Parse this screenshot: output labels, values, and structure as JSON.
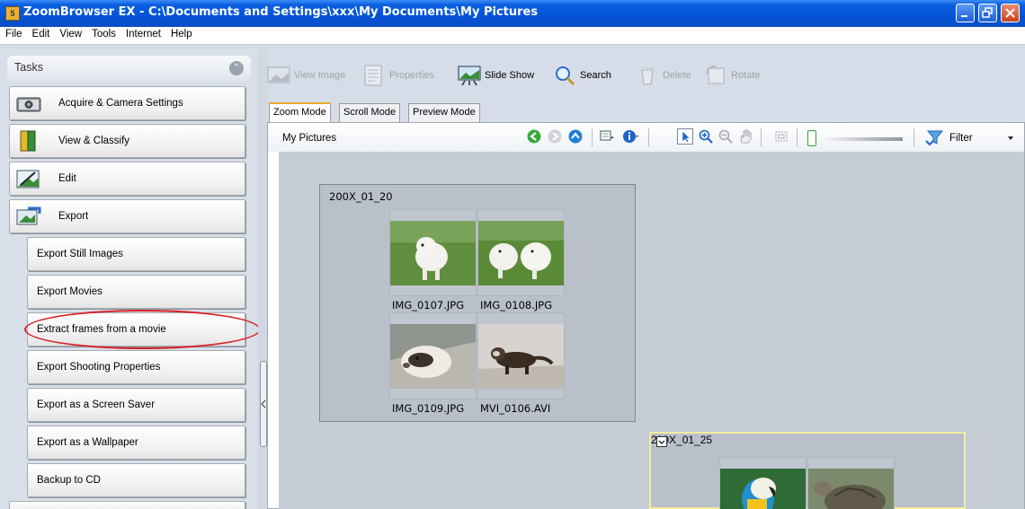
{
  "window": {
    "title": "ZoomBrowser EX  -  C:\\Documents and Settings\\xxx\\My Documents\\My Pictures"
  },
  "menubar": [
    "File",
    "Edit",
    "View",
    "Tools",
    "Internet",
    "Help"
  ],
  "tasks": {
    "header": "Tasks",
    "buttons": [
      {
        "label": "Acquire & Camera Settings",
        "icon": "camera-icon"
      },
      {
        "label": "View & Classify",
        "icon": "book-icon"
      },
      {
        "label": "Edit",
        "icon": "edit-icon"
      },
      {
        "label": "Export",
        "icon": "export-icon"
      }
    ],
    "export_items": [
      "Export Still Images",
      "Export Movies",
      "Extract frames from a movie",
      "Export Shooting Properties",
      "Export as a Screen Saver",
      "Export as a Wallpaper",
      "Backup to CD"
    ],
    "highlighted_item": "Extract frames from a movie"
  },
  "toolbar": {
    "view_image": "View Image",
    "properties": "Properties",
    "slide_show": "Slide Show",
    "search": "Search",
    "delete": "Delete",
    "rotate": "Rotate"
  },
  "tabs": [
    "Zoom Mode",
    "Scroll Mode",
    "Preview Mode"
  ],
  "active_tab": "Zoom Mode",
  "viewer": {
    "path": "My Pictures",
    "filter": "Filter"
  },
  "groups": [
    {
      "title": "200X_01_20",
      "files": [
        "IMG_0107.JPG",
        "IMG_0108.JPG",
        "IMG_0109.JPG",
        "MVI_0106.AVI"
      ]
    },
    {
      "title": "200X_01_25"
    }
  ],
  "colors": {
    "titlebar": "#0454d8",
    "highlight_ring": "#d8232a",
    "active_tab_accent": "#f0a830",
    "selected_group_border": "#f5ec9c"
  }
}
